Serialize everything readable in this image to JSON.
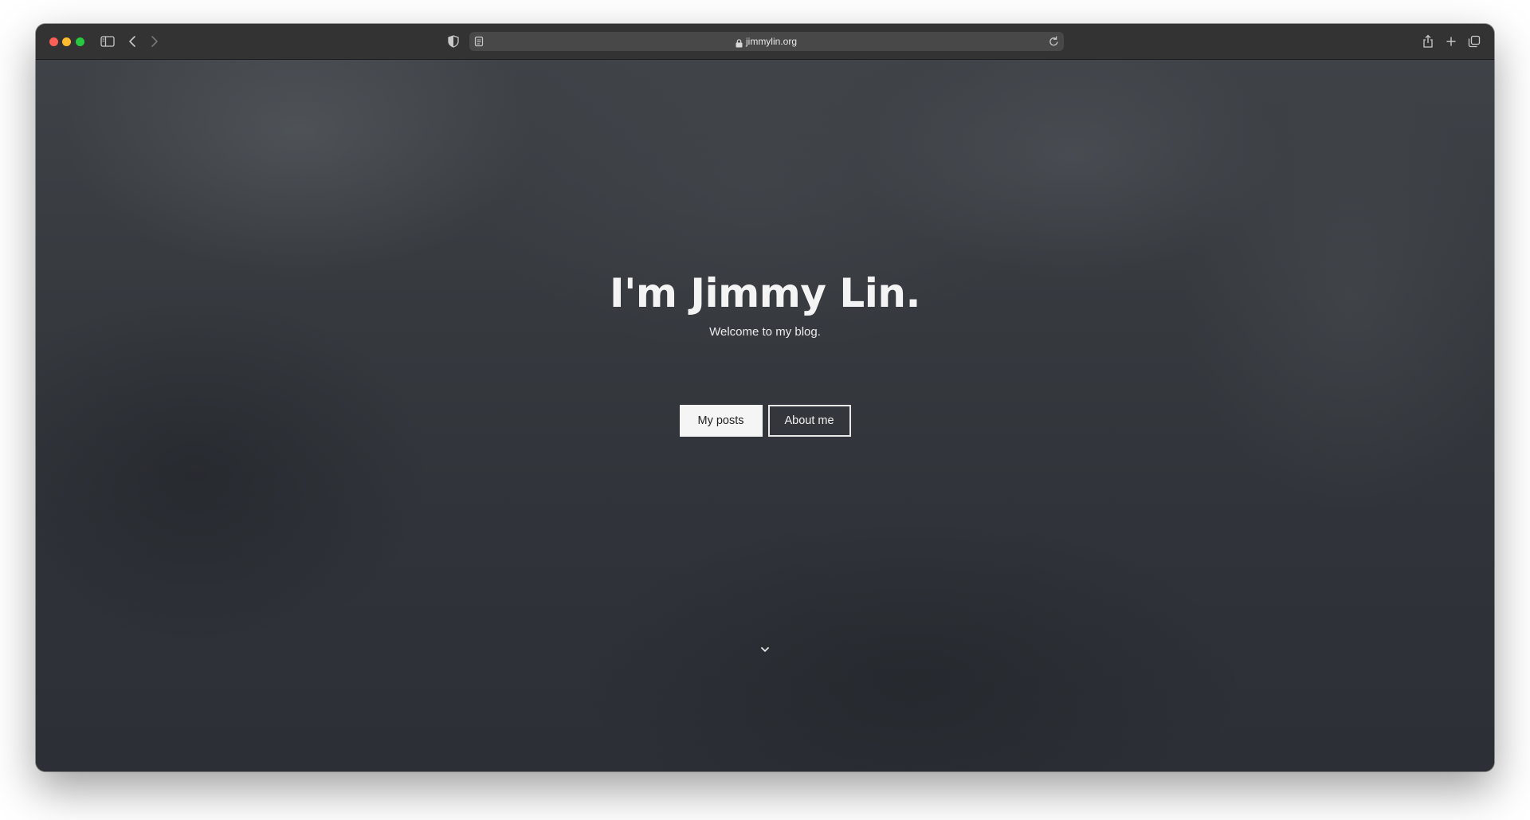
{
  "browser": {
    "url": "jimmylin.org",
    "icons": {
      "sidebar": "sidebar-icon",
      "back": "chevron-left-icon",
      "forward": "chevron-right-icon",
      "privacy": "shield-icon",
      "reader": "reader-icon",
      "lock": "lock-icon",
      "reload": "reload-icon",
      "share": "share-icon",
      "new_tab": "plus-icon",
      "tabs": "tabs-overview-icon"
    },
    "traffic_colors": {
      "close": "#fe5f57",
      "minimize": "#febc2e",
      "zoom": "#28c840"
    }
  },
  "hero": {
    "title": "I'm Jimmy Lin.",
    "subtitle": "Welcome to my blog."
  },
  "buttons": {
    "posts": "My posts",
    "about": "About me"
  },
  "scroll_indicator": "chevron-down-icon"
}
